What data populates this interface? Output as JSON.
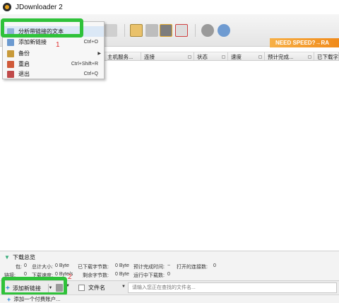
{
  "window": {
    "title": "JDownloader 2"
  },
  "menu": {
    "items": [
      {
        "label": "分析带链接的文本",
        "shortcut": ""
      },
      {
        "label": "添加新链接",
        "shortcut": "Ctrl+O"
      },
      {
        "label": "备份",
        "shortcut": ""
      },
      {
        "label": "重启",
        "shortcut": "Ctrl+Shift+R"
      },
      {
        "label": "退出",
        "shortcut": "Ctrl+Q"
      }
    ]
  },
  "annotations": {
    "num1": "1",
    "num2": "2"
  },
  "banner": {
    "text": "NEED SPEED?→RA"
  },
  "columns": [
    {
      "label": "主机服务..."
    },
    {
      "label": "连接"
    },
    {
      "label": "状态"
    },
    {
      "label": "速度"
    },
    {
      "label": "预计完成..."
    },
    {
      "label": "已下载字"
    }
  ],
  "panel": {
    "title": "下载总览",
    "stats": {
      "pkg_label": "包:",
      "pkg_value": "0",
      "total_size_label": "总计大小:",
      "total_size_value": "0 Byte",
      "downloaded_label": "已下载字节数:",
      "downloaded_value": "0 Byte",
      "eta_label": "预计完成时间:",
      "eta_value": "~",
      "connections_label": "打开的连接数:",
      "connections_value": "0",
      "links_label": "链接:",
      "links_value": "0",
      "speed_label": "下载速度:",
      "speed_value": "0 Byte/s",
      "remaining_label": "剩余字节数:",
      "remaining_value": "0 Byte",
      "running_label": "运行中下载数:",
      "running_value": "0"
    }
  },
  "bottom": {
    "add_link_label": "添加新链接",
    "file_label": "文件名",
    "search_placeholder": "请输入您正在查找的文件名..."
  },
  "status": {
    "add_account": "添加一个付费账户..."
  },
  "colors": {
    "highlight": "#2fc23a",
    "annotation": "#e03030",
    "banner": "#f08a1a"
  }
}
